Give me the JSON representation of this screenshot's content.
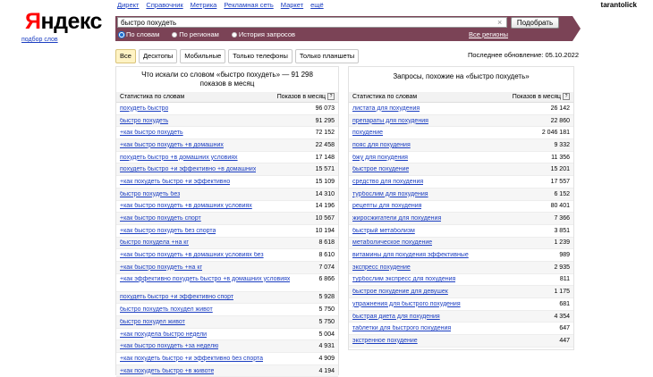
{
  "brand": {
    "logo_first": "Я",
    "logo_rest": "ндекс",
    "sublogo": "подбор слов"
  },
  "topnav": [
    "Директ",
    "Справочник",
    "Метрика",
    "Рекламная сеть",
    "Маркет",
    "ещё"
  ],
  "user": "tarantolick",
  "search": {
    "value": "быстро похудеть",
    "button": "Подобрать",
    "clear": "×"
  },
  "radios": [
    {
      "label": "По словам",
      "selected": true
    },
    {
      "label": "По регионам",
      "selected": false
    },
    {
      "label": "История запросов",
      "selected": false
    }
  ],
  "regions_link": "Все регионы",
  "tabs": [
    {
      "label": "Все",
      "active": true
    },
    {
      "label": "Десктопы",
      "active": false
    },
    {
      "label": "Мобильные",
      "active": false
    },
    {
      "label": "Только телефоны",
      "active": false
    },
    {
      "label": "Только планшеты",
      "active": false
    }
  ],
  "updated": "Последнее обновление: 05.10.2022",
  "left": {
    "title_line1": "Что искали со словом «быстро похудеть» — 91 298",
    "title_line2": "показов в месяц",
    "col1": "Статистика по словам",
    "col2": "Показов в месяц",
    "help": "?",
    "rows": [
      {
        "q": "похудеть быстро",
        "n": "96 073"
      },
      {
        "q": "быстро похудеть",
        "n": "91 295"
      },
      {
        "q": "+как быстро похудеть",
        "n": "72 152"
      },
      {
        "q": "+как быстро похудеть +в домашних",
        "n": "22 458"
      },
      {
        "q": "похудеть быстро +в домашних условиях",
        "n": "17 148"
      },
      {
        "q": "похудеть быстро +и эффективно +в домашних",
        "n": "15 571"
      },
      {
        "q": "+как похудеть быстро +и эффективно",
        "n": "15 109"
      },
      {
        "q": "быстро похудеть без",
        "n": "14 310"
      },
      {
        "q": "+как быстро похудеть +в домашних условиях",
        "n": "14 196"
      },
      {
        "q": "+как быстро похудеть спорт",
        "n": "10 567"
      },
      {
        "q": "+как быстро похудеть без спорта",
        "n": "10 194"
      },
      {
        "q": "быстро похудела +на кг",
        "n": "8 618"
      },
      {
        "q": "+как быстро похудеть +в домашних условиях без",
        "n": "8 610"
      },
      {
        "q": "+как быстро похудеть +на кг",
        "n": "7 074"
      },
      {
        "q": "+как эффективно похудеть быстро +в домашних условиях",
        "n": "6 866",
        "tall": true
      },
      {
        "q": "похудеть быстро +и эффективно спорт",
        "n": "5 928"
      },
      {
        "q": "быстро похудеть похудел живот",
        "n": "5 750"
      },
      {
        "q": "быстро похудел живот",
        "n": "5 750"
      },
      {
        "q": "+как похудела быстро недели",
        "n": "5 004"
      },
      {
        "q": "+как быстро похудеть +за неделю",
        "n": "4 931"
      },
      {
        "q": "+как похудеть быстро +и эффективно без спорта",
        "n": "4 909"
      },
      {
        "q": "+как похудеть быстро +в животе",
        "n": "4 194"
      }
    ]
  },
  "right": {
    "title": "Запросы, похожие на «быстро похудеть»",
    "col1": "Статистика по словам",
    "col2": "Показов в месяц",
    "help": "?",
    "rows": [
      {
        "q": "листата для похудения",
        "n": "26 142"
      },
      {
        "q": "препараты для похудения",
        "n": "22 860"
      },
      {
        "q": "похудение",
        "n": "2 046 181"
      },
      {
        "q": "пояс для похудения",
        "n": "9 332"
      },
      {
        "q": "бжу для похудения",
        "n": "11 356"
      },
      {
        "q": "быстрое похудение",
        "n": "15 201"
      },
      {
        "q": "средство для похудения",
        "n": "17 557"
      },
      {
        "q": "турбослим для похудения",
        "n": "6 152"
      },
      {
        "q": "рецепты для похудения",
        "n": "80 401"
      },
      {
        "q": "жиросжигатели для похудения",
        "n": "7 366"
      },
      {
        "q": "быстрый метаболизм",
        "n": "3 851"
      },
      {
        "q": "метаболическое похудение",
        "n": "1 239"
      },
      {
        "q": "витамины для похудения эффективные",
        "n": "989"
      },
      {
        "q": "экспресс похудение",
        "n": "2 935"
      },
      {
        "q": "турбослим экспресс для похудения",
        "n": "811"
      },
      {
        "q": "быстрое похудение для девушек",
        "n": "1 175"
      },
      {
        "q": "упражнения для быстрого похудения",
        "n": "681"
      },
      {
        "q": "быстрая диета для похудения",
        "n": "4 354"
      },
      {
        "q": "таблетки для быстрого похудения",
        "n": "647"
      },
      {
        "q": "экстренное похудение",
        "n": "447"
      }
    ]
  }
}
